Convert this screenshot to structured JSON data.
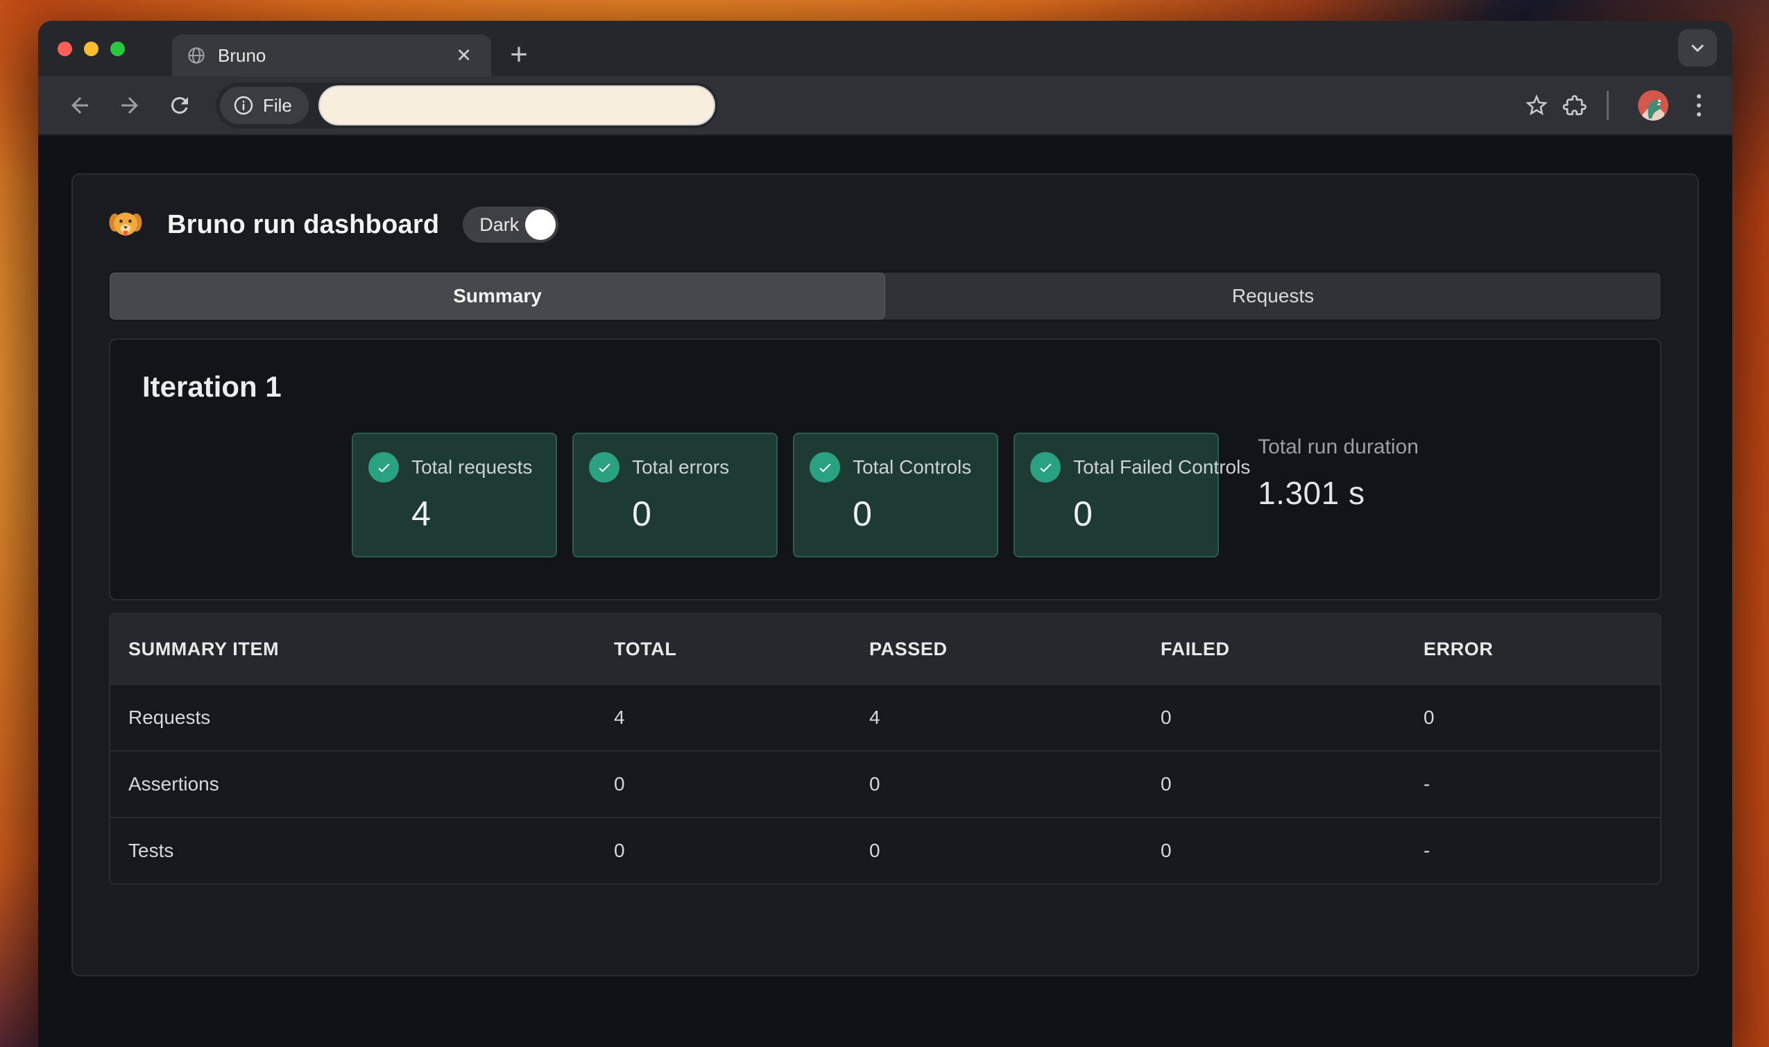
{
  "browser": {
    "tab_title": "Bruno",
    "chip_label": "File",
    "glyphs": {
      "tab_close": "✕",
      "new_tab": "+"
    }
  },
  "dashboard": {
    "title": "Bruno run dashboard",
    "theme_toggle_label": "Dark",
    "tabs": [
      {
        "label": "Summary",
        "active": true
      },
      {
        "label": "Requests",
        "active": false
      }
    ],
    "iteration": {
      "heading": "Iteration 1",
      "stats": [
        {
          "label": "Total requests",
          "value": "4"
        },
        {
          "label": "Total errors",
          "value": "0"
        },
        {
          "label": "Total Controls",
          "value": "0"
        },
        {
          "label": "Total Failed Controls",
          "value": "0"
        }
      ],
      "duration": {
        "label": "Total run duration",
        "value": "1.301 s"
      }
    },
    "table": {
      "headers": [
        "SUMMARY ITEM",
        "TOTAL",
        "PASSED",
        "FAILED",
        "ERROR"
      ],
      "rows": [
        {
          "item": "Requests",
          "total": "4",
          "passed": "4",
          "failed": "0",
          "error": "0"
        },
        {
          "item": "Assertions",
          "total": "0",
          "passed": "0",
          "failed": "0",
          "error": "-"
        },
        {
          "item": "Tests",
          "total": "0",
          "passed": "0",
          "failed": "0",
          "error": "-"
        }
      ]
    }
  },
  "icons": {
    "favicon": "globe",
    "tab_search": "chevron-down",
    "back": "arrow-left",
    "forward": "arrow-right",
    "reload": "refresh",
    "site_info": "info-circle",
    "bookmark": "star-outline",
    "extensions": "puzzle-piece",
    "menu": "kebab-dots",
    "stat_check": "check-circle",
    "dashboard_logo": "dog-face-emoji",
    "avatar": "dinosaur-profile-photo"
  },
  "colors": {
    "accent_green": "#2aa181",
    "stat_card_bg": "#1d3a33",
    "stat_card_border": "#2e5b4f",
    "url_highlight": "#f7eedd",
    "traffic_red": "#ff5f57",
    "traffic_yellow": "#febc2e",
    "traffic_green": "#28c840"
  }
}
